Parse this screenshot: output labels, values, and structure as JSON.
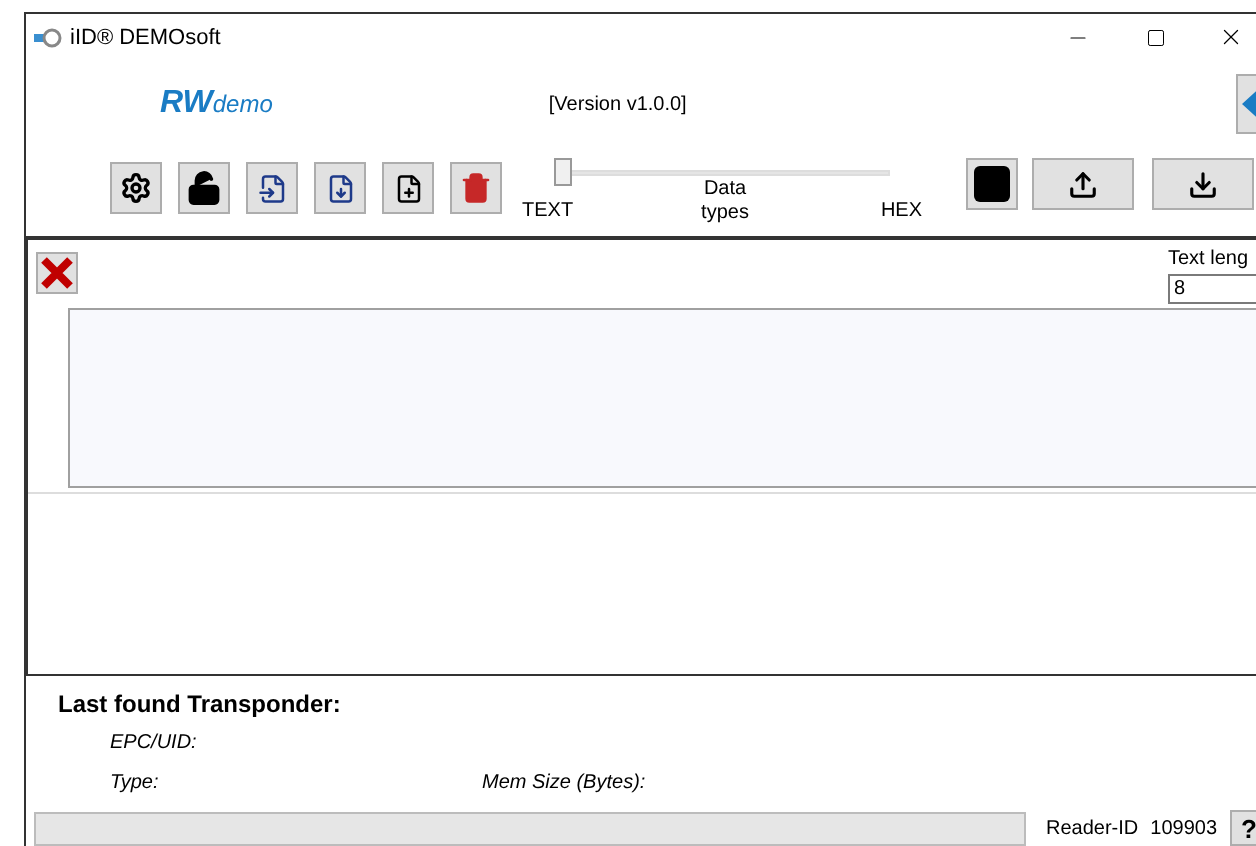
{
  "window": {
    "title": "iID® DEMOsoft"
  },
  "header": {
    "logo_main": "RW",
    "logo_sub": "demo",
    "version": "[Version v1.0.0]"
  },
  "toolbar": {
    "data_type_slider": {
      "level": 0,
      "left_label": "TEXT",
      "center_label": "Data types",
      "right_label": "HEX"
    }
  },
  "editor": {
    "text_length_label": "Text leng",
    "text_length_value": "8"
  },
  "transponder": {
    "title": "Last found Transponder:",
    "epc_label": "EPC/UID:",
    "type_label": "Type:",
    "mem_size_label": "Mem Size (Bytes):"
  },
  "status_bar": {
    "reader_id_label": "Reader-ID",
    "reader_id": "109903",
    "help": "?"
  }
}
